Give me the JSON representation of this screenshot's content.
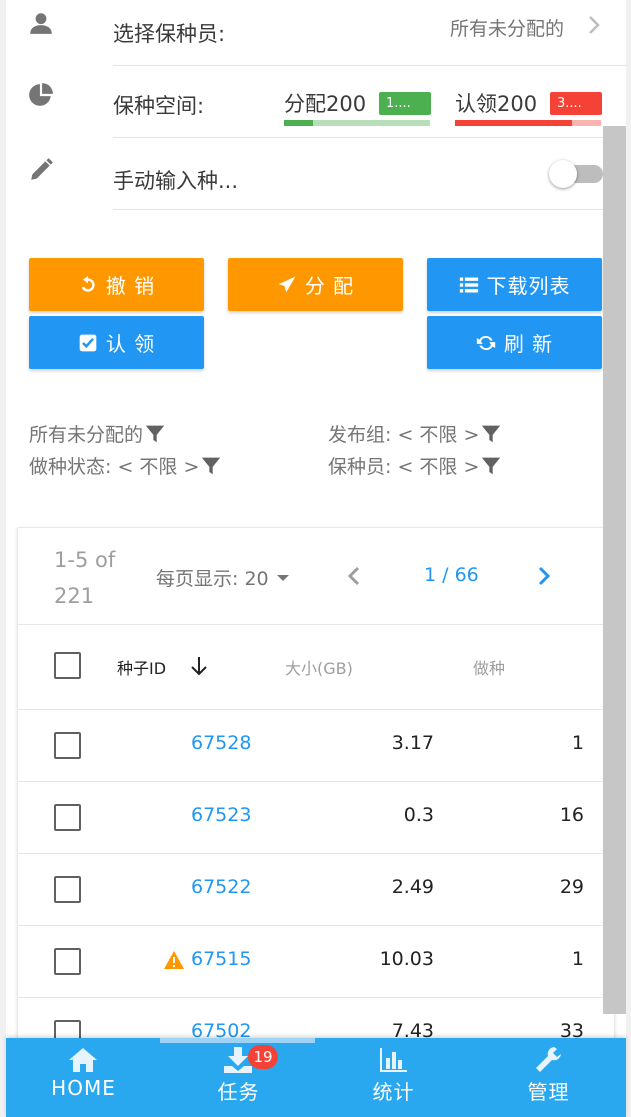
{
  "settings": {
    "keeper_label": "选择保种员:",
    "keeper_value": "所有未分配的",
    "space_label": "保种空间:",
    "assign_text": "分配200",
    "assign_badge": "1....",
    "assign_progress": 0.2,
    "assign_color": "#4caf50",
    "claim_text": "认领200",
    "claim_badge": "3....",
    "claim_progress": 0.8,
    "claim_color": "#f44336",
    "manual_label": "手动输入种...",
    "manual_enabled": false
  },
  "actions": {
    "undo": "撤 销",
    "assign": "分 配",
    "download_list": "下载列表",
    "claim": "认 领",
    "refresh": "刷 新"
  },
  "filters": {
    "unassigned": "所有未分配的",
    "group": "发布组: < 不限 >",
    "seed_status": "做种状态: < 不限 >",
    "keeper": "保种员: < 不限 >"
  },
  "table": {
    "range": "1-5 of 221",
    "per_page": "每页显示: 20",
    "page": "1 / 66",
    "columns": {
      "id": "种子ID",
      "size": "大小(GB)",
      "seeding": "做种"
    },
    "rows": [
      {
        "id": "67528",
        "size": "3.17",
        "seeding": "1",
        "warning": false
      },
      {
        "id": "67523",
        "size": "0.3",
        "seeding": "16",
        "warning": false
      },
      {
        "id": "67522",
        "size": "2.49",
        "seeding": "29",
        "warning": false
      },
      {
        "id": "67515",
        "size": "10.03",
        "seeding": "1",
        "warning": true
      },
      {
        "id": "67502",
        "size": "7.43",
        "seeding": "33",
        "warning": false
      }
    ]
  },
  "nav": {
    "home": "HOME",
    "tasks": "任务",
    "tasks_badge": "19",
    "stats": "统计",
    "manage": "管理",
    "active": "tasks"
  },
  "colors": {
    "primary": "#2196f3",
    "accent": "#ff9800",
    "nav_bg": "#29a8f0"
  }
}
